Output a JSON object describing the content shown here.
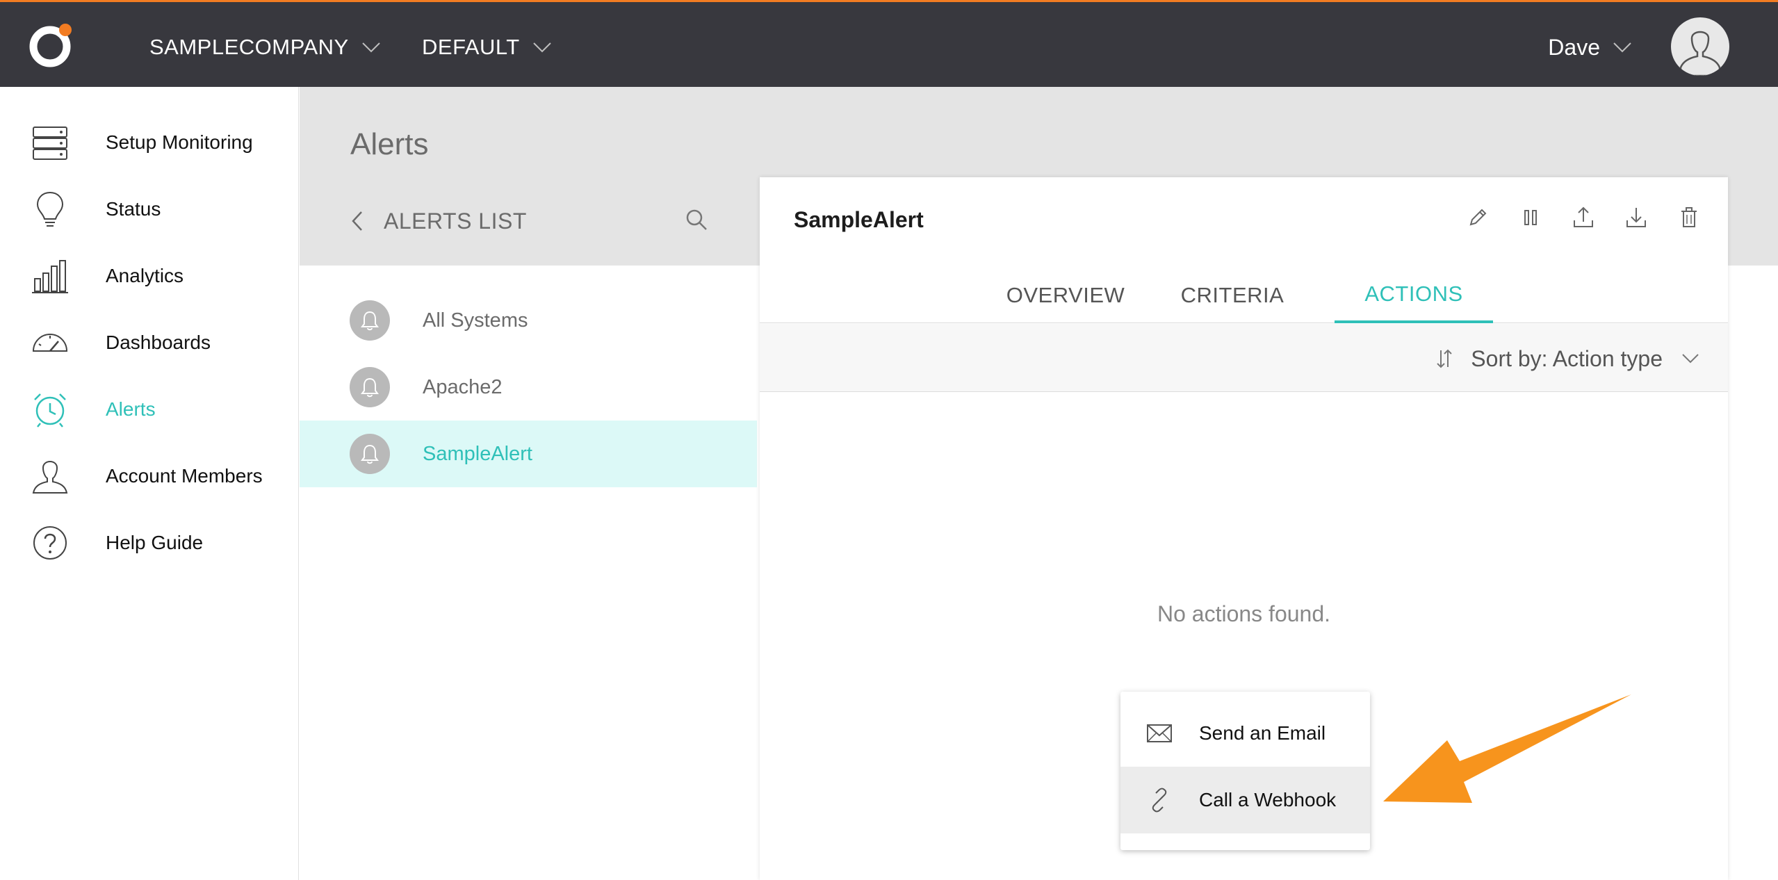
{
  "topbar": {
    "company": "SAMPLECOMPANY",
    "environment": "DEFAULT",
    "user": "Dave"
  },
  "sidebar": {
    "items": [
      {
        "label": "Setup Monitoring",
        "icon": "server-icon"
      },
      {
        "label": "Status",
        "icon": "lightbulb-icon"
      },
      {
        "label": "Analytics",
        "icon": "bar-chart-icon"
      },
      {
        "label": "Dashboards",
        "icon": "gauge-icon"
      },
      {
        "label": "Alerts",
        "icon": "alarm-clock-icon",
        "active": true
      },
      {
        "label": "Account Members",
        "icon": "user-icon"
      },
      {
        "label": "Help Guide",
        "icon": "question-icon"
      }
    ]
  },
  "page": {
    "title": "Alerts"
  },
  "alerts_list": {
    "title": "ALERTS LIST",
    "items": [
      {
        "label": "All Systems"
      },
      {
        "label": "Apache2"
      },
      {
        "label": "SampleAlert",
        "selected": true
      }
    ]
  },
  "detail": {
    "title": "SampleAlert",
    "tools": [
      "pencil-icon",
      "pause-icon",
      "upload-icon",
      "download-icon",
      "trash-icon"
    ],
    "tabs": [
      {
        "label": "OVERVIEW"
      },
      {
        "label": "CRITERIA"
      },
      {
        "label": "ACTIONS",
        "active": true
      }
    ],
    "sort_label": "Sort by: Action type",
    "empty_message": "No actions found."
  },
  "action_menu": {
    "items": [
      {
        "label": "Send an Email",
        "icon": "envelope-icon"
      },
      {
        "label": "Call a Webhook",
        "icon": "link-icon",
        "hover": true
      }
    ]
  },
  "colors": {
    "topbar": "#38383e",
    "accent": "#2fc0b8",
    "brand_orange": "#f27c22",
    "selected_row": "#dcf9f7",
    "annotation_arrow": "#f7941d"
  }
}
